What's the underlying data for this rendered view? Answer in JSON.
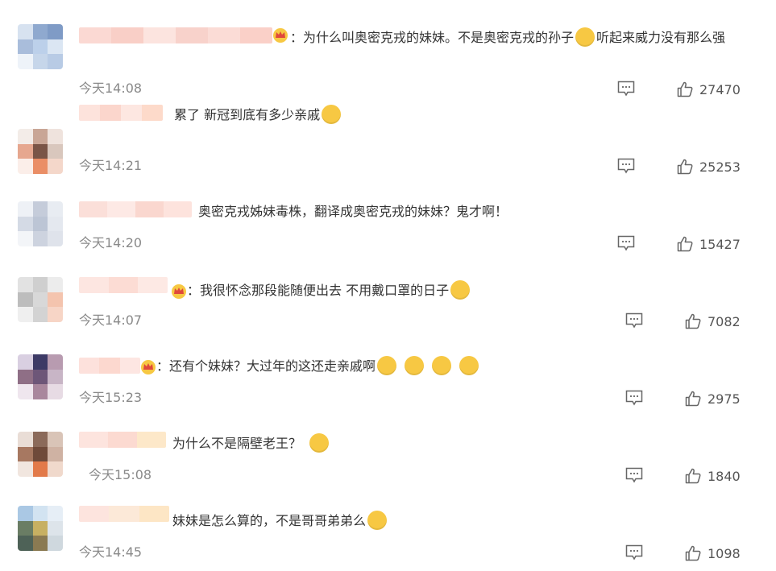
{
  "comments": [
    {
      "text": "为什么叫奥密克戎的妹妹。不是奥密克戎的孙子",
      "text_after": "听起来威力没有那么强",
      "time": "今天14:08",
      "likes": "27470"
    },
    {
      "text": "累了 新冠到底有多少亲戚",
      "time": "今天14:21",
      "likes": "25253"
    },
    {
      "text": "奥密克戎姊妹毒株，翻译成奥密克戎的妹妹？鬼才啊！",
      "time": "今天14:20",
      "likes": "15427"
    },
    {
      "text": "我很怀念那段能随便出去 不用戴口罩的日子",
      "time": "今天14:07",
      "likes": "7082"
    },
    {
      "text": "还有个妹妹？大过年的这还走亲戚啊",
      "time": "今天15:23",
      "likes": "2975"
    },
    {
      "text": "为什么不是隔壁老王？",
      "time": "今天15:08",
      "likes": "1840"
    },
    {
      "text": "妹妹是怎么算的，不是哥哥弟弟么",
      "time": "今天14:45",
      "likes": "1098"
    }
  ],
  "icons": {
    "reply": "comment-icon",
    "like": "thumbs-up-icon",
    "crown": "vip-crown-icon"
  },
  "colors": {
    "accent_crown": "#e0483b",
    "emoji_yellow": "#f7c843",
    "time": "#8a8a8a"
  }
}
